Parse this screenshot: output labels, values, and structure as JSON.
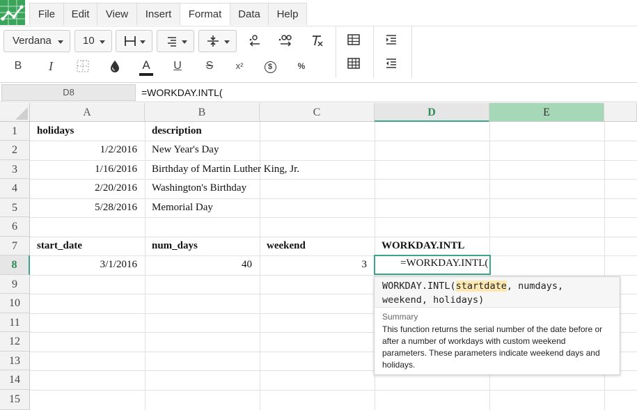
{
  "menu": {
    "items": [
      "File",
      "Edit",
      "View",
      "Insert",
      "Format",
      "Data",
      "Help"
    ],
    "active": "Format"
  },
  "toolbar": {
    "font_family": "Verdana",
    "font_size": "10",
    "icons": {
      "borders": "borders-icon",
      "align": "align-icon",
      "valign": "vertical-align-icon",
      "dec_decrease": "decrease-decimal-icon",
      "dec_increase": "increase-decimal-icon",
      "clear_format": "clear-format-icon",
      "bold": "B",
      "italic": "I",
      "borders_all": "border-all-icon",
      "fill": "fill-color-icon",
      "text_color": "A",
      "underline": "U",
      "strike": "S",
      "superscript": "x²",
      "currency": "$",
      "percent": "%"
    }
  },
  "formula_bar": {
    "name_box": "D8",
    "formula": "=WORKDAY.INTL("
  },
  "grid": {
    "columns": [
      "A",
      "B",
      "C",
      "D",
      "E"
    ],
    "rows": [
      "1",
      "2",
      "3",
      "4",
      "5",
      "6",
      "7",
      "8",
      "9",
      "10",
      "11",
      "12",
      "13",
      "14",
      "15"
    ],
    "cells": {
      "A1": "holidays",
      "B1": "description",
      "A2": "1/2/2016",
      "B2": "New Year's Day",
      "A3": "1/16/2016",
      "B3": "Birthday of Martin Luther King, Jr.",
      "A4": "2/20/2016",
      "B4": "Washington's Birthday",
      "A5": "5/28/2016",
      "B5": "Memorial Day",
      "A7": "start_date",
      "B7": "num_days",
      "C7": "weekend",
      "D7": "WORKDAY.INTL",
      "A8": "3/1/2016",
      "B8": "40",
      "C8": "3",
      "D8": "=WORKDAY.INTL("
    }
  },
  "tooltip": {
    "sig_name": "WORKDAY.INTL(",
    "sig_active_param": "startdate",
    "sig_rest_line1": ", numdays,",
    "sig_line2": "weekend, holidays)",
    "heading": "Summary",
    "body": "This function returns the serial number of the date before or after a number of workdays with custom weekend parameters. These parameters indicate weekend days and holidays."
  },
  "colors": {
    "accent": "#3aa58a",
    "selected_text": "#2e8b57",
    "highlight_column": "#a6d8b8",
    "param_highlight": "#fde8b2"
  }
}
